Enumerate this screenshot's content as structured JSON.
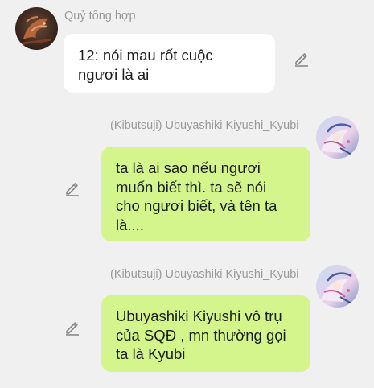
{
  "messages": [
    {
      "sender": "Quỷ tổng hợp",
      "text": "12: nói mau rốt cuộc\nngươi là ai",
      "avatar_icon": "dragon-avatar-icon",
      "edit_icon": "pencil-icon"
    },
    {
      "sender": "(Kibutsuji) Ubuyashiki Kiyushi_Kyubi",
      "text": "ta là ai sao nếu ngươi\nmuốn biết  thì. ta sẽ nói\ncho ngươi biết, và tên ta\nlà....",
      "avatar_icon": "anime-character-avatar-icon",
      "edit_icon": "pencil-icon"
    },
    {
      "sender": "(Kibutsuji) Ubuyashiki Kiyushi_Kyubi",
      "text": "Ubuyashiki Kiyushi vô trụ\ncủa SQĐ , mn thường gọi\nta là Kyubi",
      "avatar_icon": "anime-character-avatar-icon",
      "edit_icon": "pencil-icon"
    }
  ],
  "colors": {
    "background": "#f0f0f0",
    "incoming_bubble": "#ffffff",
    "outgoing_bubble": "#d4f58c",
    "sender_text": "#9a9a9a",
    "message_text": "#1d1d1d",
    "icon": "#8a8a8a"
  }
}
